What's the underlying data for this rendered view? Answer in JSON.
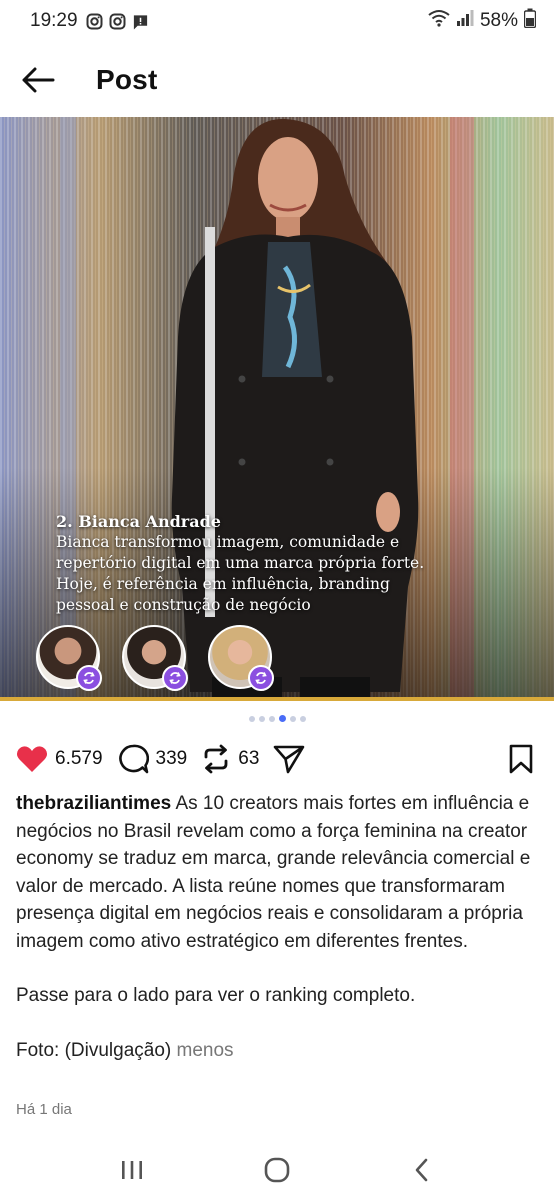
{
  "status_bar": {
    "time": "19:29",
    "battery": "58%",
    "left_icons": [
      "instagram-icon",
      "instagram-icon",
      "message-icon"
    ],
    "right_icons": [
      "wifi-icon",
      "signal-icon",
      "battery-icon"
    ]
  },
  "header": {
    "title": "Post"
  },
  "slide": {
    "name": "2. Bianca Andrade",
    "lines": [
      "Bianca transformou imagem, comunidade e",
      "repertório digital em uma marca própria forte.",
      "Hoje, é referência em influência, branding",
      "pessoal e construção de negócio"
    ]
  },
  "carousel": {
    "dot_count": 6,
    "active_index": 3
  },
  "actions": {
    "likes": "6.579",
    "comments": "339",
    "reposts": "63"
  },
  "caption": {
    "username": "thebraziliantimes",
    "text": "As 10 creators mais fortes em influência e negócios no Brasil revelam como a força feminina na creator economy se traduz em marca, grande relevância comercial e valor de mercado. A lista reúne nomes que transformaram presença digital em negócios reais e consolidaram a própria imagem como ativo estratégico em diferentes frentes.",
    "cta": "Passe para o lado para ver o ranking completo.",
    "credit": "Foto: (Divulgação)",
    "less_label": "menos"
  },
  "timestamp": "Há 1 dia",
  "colors": {
    "like": "#e8304a",
    "accent": "#4a6cf7",
    "gold": "#d8a93a",
    "badge": "#8b4fe0"
  }
}
